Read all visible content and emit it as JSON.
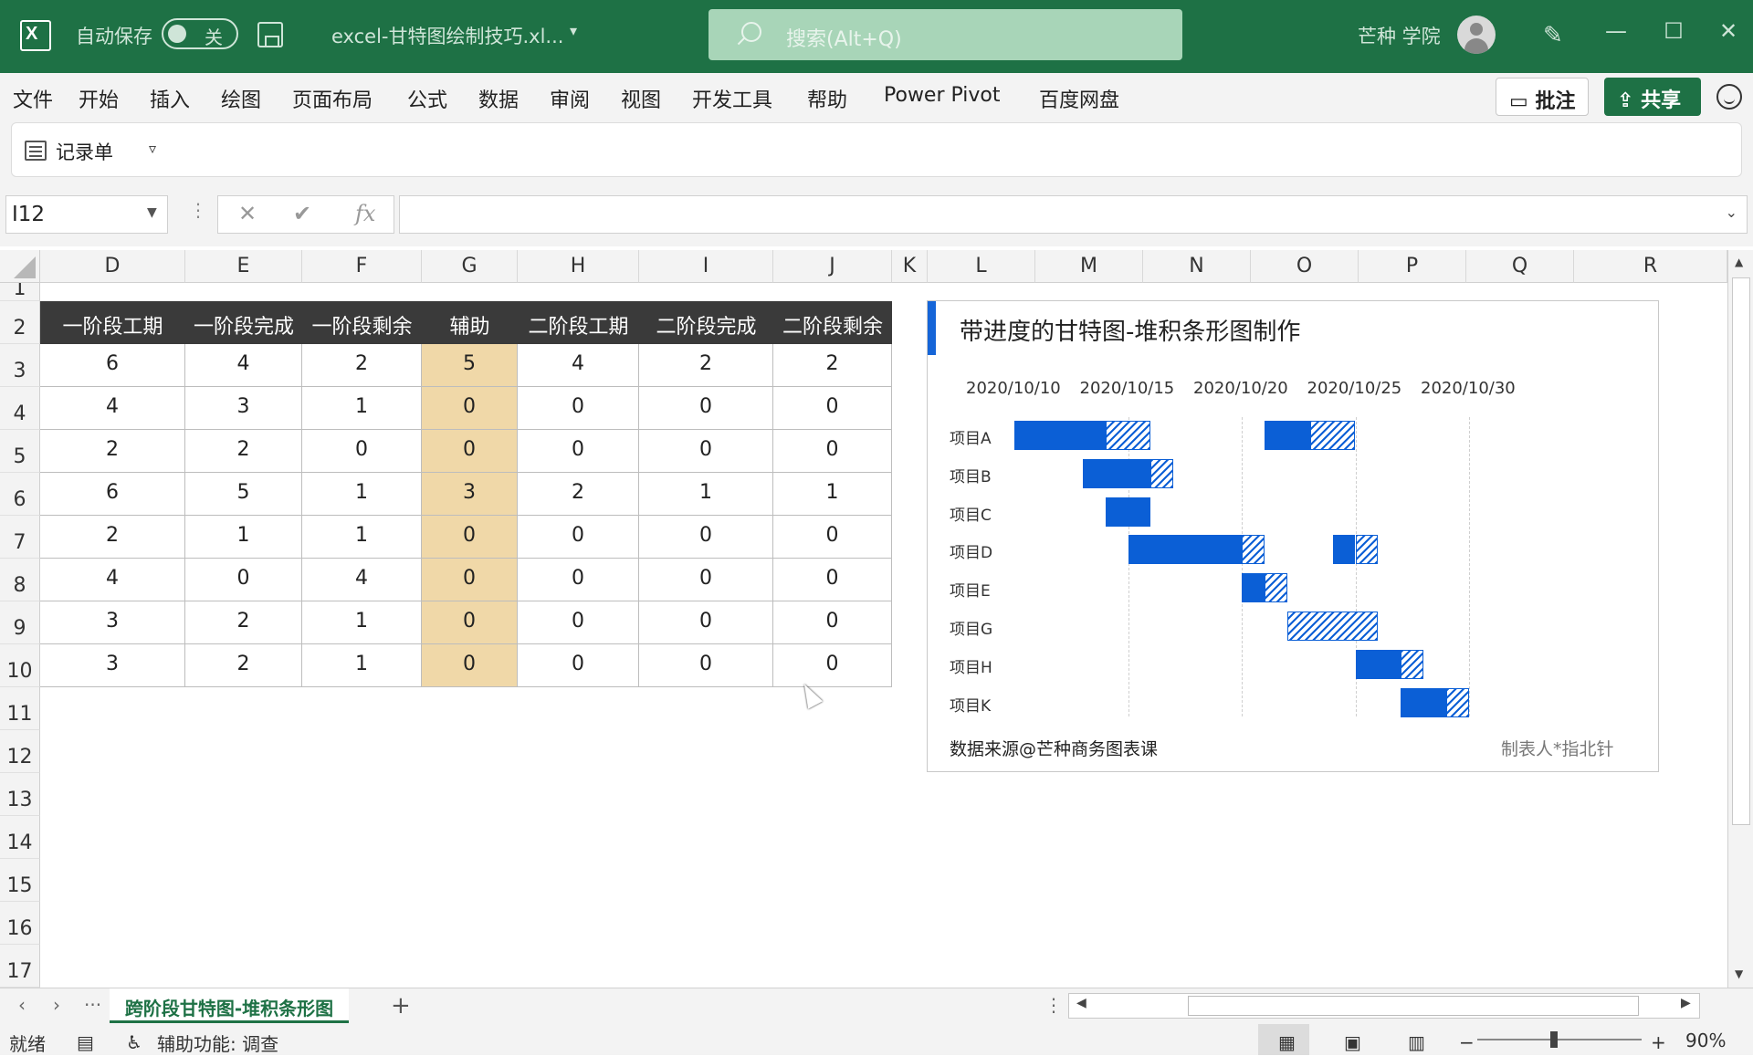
{
  "titlebar": {
    "autosave_label": "自动保存",
    "autosave_state": "关",
    "doc_title": "excel-甘特图绘制技巧.xl...",
    "search_placeholder": "搜索(Alt+Q)",
    "user_name": "芒种 学院",
    "minimize": "—",
    "maximize": "☐",
    "close": "✕",
    "theme_color": "#1e7145"
  },
  "menu": {
    "items": [
      "文件",
      "开始",
      "插入",
      "绘图",
      "页面布局",
      "公式",
      "数据",
      "审阅",
      "视图",
      "开发工具",
      "帮助",
      "Power Pivot",
      "百度网盘"
    ],
    "comments_label": "批注",
    "share_label": "共享"
  },
  "ribbon": {
    "form_label": "记录单"
  },
  "formula_bar": {
    "name_box": "I12",
    "cancel": "✕",
    "enter": "✔",
    "fx": "fx",
    "formula": ""
  },
  "grid": {
    "columns": [
      "D",
      "E",
      "F",
      "G",
      "H",
      "I",
      "J",
      "K",
      "L",
      "M",
      "N",
      "O",
      "P",
      "Q",
      "R"
    ],
    "rows": [
      "1",
      "2",
      "3",
      "4",
      "5",
      "6",
      "7",
      "8",
      "9",
      "10",
      "11",
      "12",
      "13",
      "14",
      "15",
      "16",
      "17"
    ],
    "table_headers": [
      "一阶段工期",
      "一阶段完成",
      "一阶段剩余",
      "辅助",
      "二阶段工期",
      "二阶段完成",
      "二阶段剩余"
    ],
    "table_rows": [
      [
        "6",
        "4",
        "2",
        "5",
        "4",
        "2",
        "2"
      ],
      [
        "4",
        "3",
        "1",
        "0",
        "0",
        "0",
        "0"
      ],
      [
        "2",
        "2",
        "0",
        "0",
        "0",
        "0",
        "0"
      ],
      [
        "6",
        "5",
        "1",
        "3",
        "2",
        "1",
        "1"
      ],
      [
        "2",
        "1",
        "1",
        "0",
        "0",
        "0",
        "0"
      ],
      [
        "4",
        "0",
        "4",
        "0",
        "0",
        "0",
        "0"
      ],
      [
        "3",
        "2",
        "1",
        "0",
        "0",
        "0",
        "0"
      ],
      [
        "3",
        "2",
        "1",
        "0",
        "0",
        "0",
        "0"
      ]
    ],
    "helper_color": "#f0d8a8",
    "header_color": "#3a3a3a"
  },
  "chart": {
    "title": "带进度的甘特图-堆积条形图制作",
    "source": "数据来源@芒种商务图表课",
    "author": "制表人*指北针",
    "bar_color": "#0b5fd6"
  },
  "chart_data": {
    "type": "bar",
    "orientation": "horizontal-stacked",
    "title": "带进度的甘特图-堆积条形图制作",
    "x_ticks": [
      "2020/10/10",
      "2020/10/15",
      "2020/10/20",
      "2020/10/25",
      "2020/10/30"
    ],
    "xlim": [
      "2020/10/10",
      "2020/10/30"
    ],
    "x_scale": "date",
    "categories": [
      "项目A",
      "项目B",
      "项目C",
      "项目D",
      "项目E",
      "项目G",
      "项目H",
      "项目K"
    ],
    "segments": [
      {
        "category": "项目A",
        "start": "2020/10/10",
        "days": 4,
        "status": "done"
      },
      {
        "category": "项目A",
        "start": "2020/10/14",
        "days": 2,
        "status": "remaining"
      },
      {
        "category": "项目A",
        "start": "2020/10/21",
        "days": 2,
        "status": "done"
      },
      {
        "category": "项目A",
        "start": "2020/10/23",
        "days": 2,
        "status": "remaining"
      },
      {
        "category": "项目B",
        "start": "2020/10/13",
        "days": 3,
        "status": "done"
      },
      {
        "category": "项目B",
        "start": "2020/10/16",
        "days": 1,
        "status": "remaining"
      },
      {
        "category": "项目C",
        "start": "2020/10/14",
        "days": 2,
        "status": "done"
      },
      {
        "category": "项目D",
        "start": "2020/10/15",
        "days": 5,
        "status": "done"
      },
      {
        "category": "项目D",
        "start": "2020/10/20",
        "days": 1,
        "status": "remaining"
      },
      {
        "category": "项目D",
        "start": "2020/10/24",
        "days": 1,
        "status": "done"
      },
      {
        "category": "项目D",
        "start": "2020/10/25",
        "days": 1,
        "status": "remaining"
      },
      {
        "category": "项目E",
        "start": "2020/10/20",
        "days": 1,
        "status": "done"
      },
      {
        "category": "项目E",
        "start": "2020/10/21",
        "days": 1,
        "status": "remaining"
      },
      {
        "category": "项目G",
        "start": "2020/10/22",
        "days": 4,
        "status": "remaining"
      },
      {
        "category": "项目H",
        "start": "2020/10/25",
        "days": 2,
        "status": "done"
      },
      {
        "category": "项目H",
        "start": "2020/10/27",
        "days": 1,
        "status": "remaining"
      },
      {
        "category": "项目K",
        "start": "2020/10/27",
        "days": 2,
        "status": "done"
      },
      {
        "category": "项目K",
        "start": "2020/10/29",
        "days": 1,
        "status": "remaining"
      }
    ],
    "grid": "vertical dashed",
    "legend": "none"
  },
  "sheets": {
    "active": "跨阶段甘特图-堆积条形图",
    "add": "+"
  },
  "status": {
    "ready": "就绪",
    "accessibility": "辅助功能: 调查",
    "zoom": "90%"
  }
}
